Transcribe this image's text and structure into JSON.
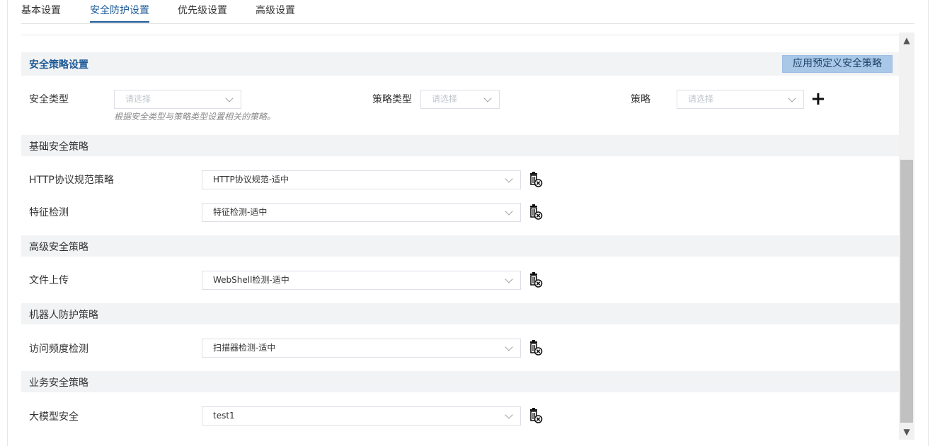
{
  "tabs": [
    {
      "label": "基本设置"
    },
    {
      "label": "安全防护设置"
    },
    {
      "label": "优先级设置"
    },
    {
      "label": "高级设置"
    }
  ],
  "section": {
    "title": "安全策略设置",
    "apply_button": "应用预定义安全策略"
  },
  "filters": {
    "security_type_label": "安全类型",
    "security_type_placeholder": "请选择",
    "policy_type_label": "策略类型",
    "policy_type_placeholder": "请选择",
    "policy_label": "策略",
    "policy_placeholder": "请选择",
    "hint": "根据安全类型与策略类型设置相关的策略。",
    "add_icon": "plus-icon"
  },
  "groups": [
    {
      "title": "基础安全策略"
    },
    {
      "title": "高级安全策略"
    },
    {
      "title": "机器人防护策略"
    },
    {
      "title": "业务安全策略"
    }
  ],
  "rows": [
    {
      "label": "HTTP协议规范策略",
      "value": "HTTP协议规范-适中"
    },
    {
      "label": "特征检测",
      "value": "特征检测-适中"
    },
    {
      "label": "文件上传",
      "value": "WebShell检测-适中"
    },
    {
      "label": "访问频度检测",
      "value": "扫描器检测-适中"
    },
    {
      "label": "大模型安全",
      "value": "test1"
    }
  ],
  "icons": {
    "delete": "trash-delete-icon",
    "scroll_up": "arrow-up-icon",
    "scroll_down": "arrow-down-icon"
  },
  "colors": {
    "accent": "#1c5a97",
    "button_bg": "#a9c8e8",
    "group_bg": "#f2f3f5"
  }
}
